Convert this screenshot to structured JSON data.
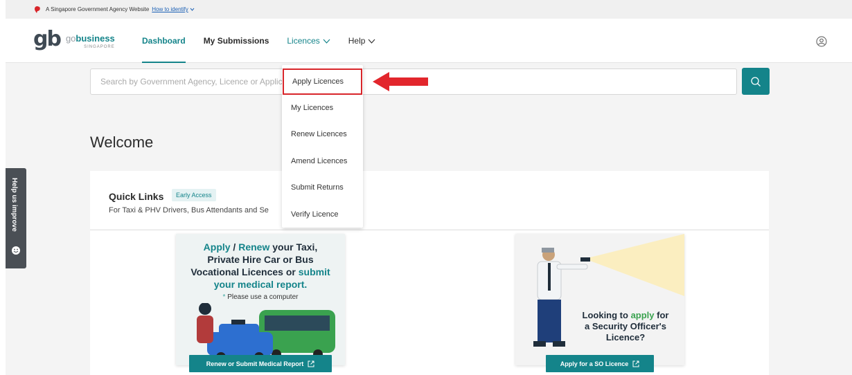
{
  "gov_banner": {
    "text": "A Singapore Government Agency Website",
    "link": "How to identify"
  },
  "logo": {
    "mark": "gb",
    "go": "go",
    "business": "business",
    "country": "SINGAPORE"
  },
  "nav": {
    "items": [
      {
        "label": "Dashboard"
      },
      {
        "label": "My Submissions"
      },
      {
        "label": "Licences"
      },
      {
        "label": "Help"
      }
    ]
  },
  "search": {
    "placeholder": "Search by Government Agency, Licence or Application"
  },
  "welcome": "Welcome",
  "dropdown": {
    "items": [
      {
        "label": "Apply Licences"
      },
      {
        "label": "My Licences"
      },
      {
        "label": "Renew Licences"
      },
      {
        "label": "Amend Licences"
      },
      {
        "label": "Submit Returns"
      },
      {
        "label": "Verify Licence"
      }
    ]
  },
  "quick_links": {
    "title": "Quick Links",
    "badge": "Early Access",
    "subtitle": "For Taxi & PHV Drivers, Bus Attendants and Se"
  },
  "taxi_card": {
    "apply": "Apply",
    "slash": " / ",
    "renew": "Renew",
    "line1_rest": " your Taxi,",
    "line2": "Private Hire Car or Bus",
    "line3": "Vocational Licences or",
    "submit": "submit",
    "line4": "your medical report.",
    "note_star": "*",
    "note": " Please use a computer",
    "button": "Renew or Submit Medical Report"
  },
  "so_card": {
    "line1_a": "Looking to ",
    "apply": "apply",
    "line1_b": " for",
    "line2": "a Security Officer's",
    "line3": "Licence?",
    "button": "Apply for a SO Licence"
  },
  "help_tab": {
    "label": "Help us improve"
  },
  "colors": {
    "brand": "#14848a",
    "highlight_box": "#d8252a",
    "help_tab": "#4a4f55"
  }
}
